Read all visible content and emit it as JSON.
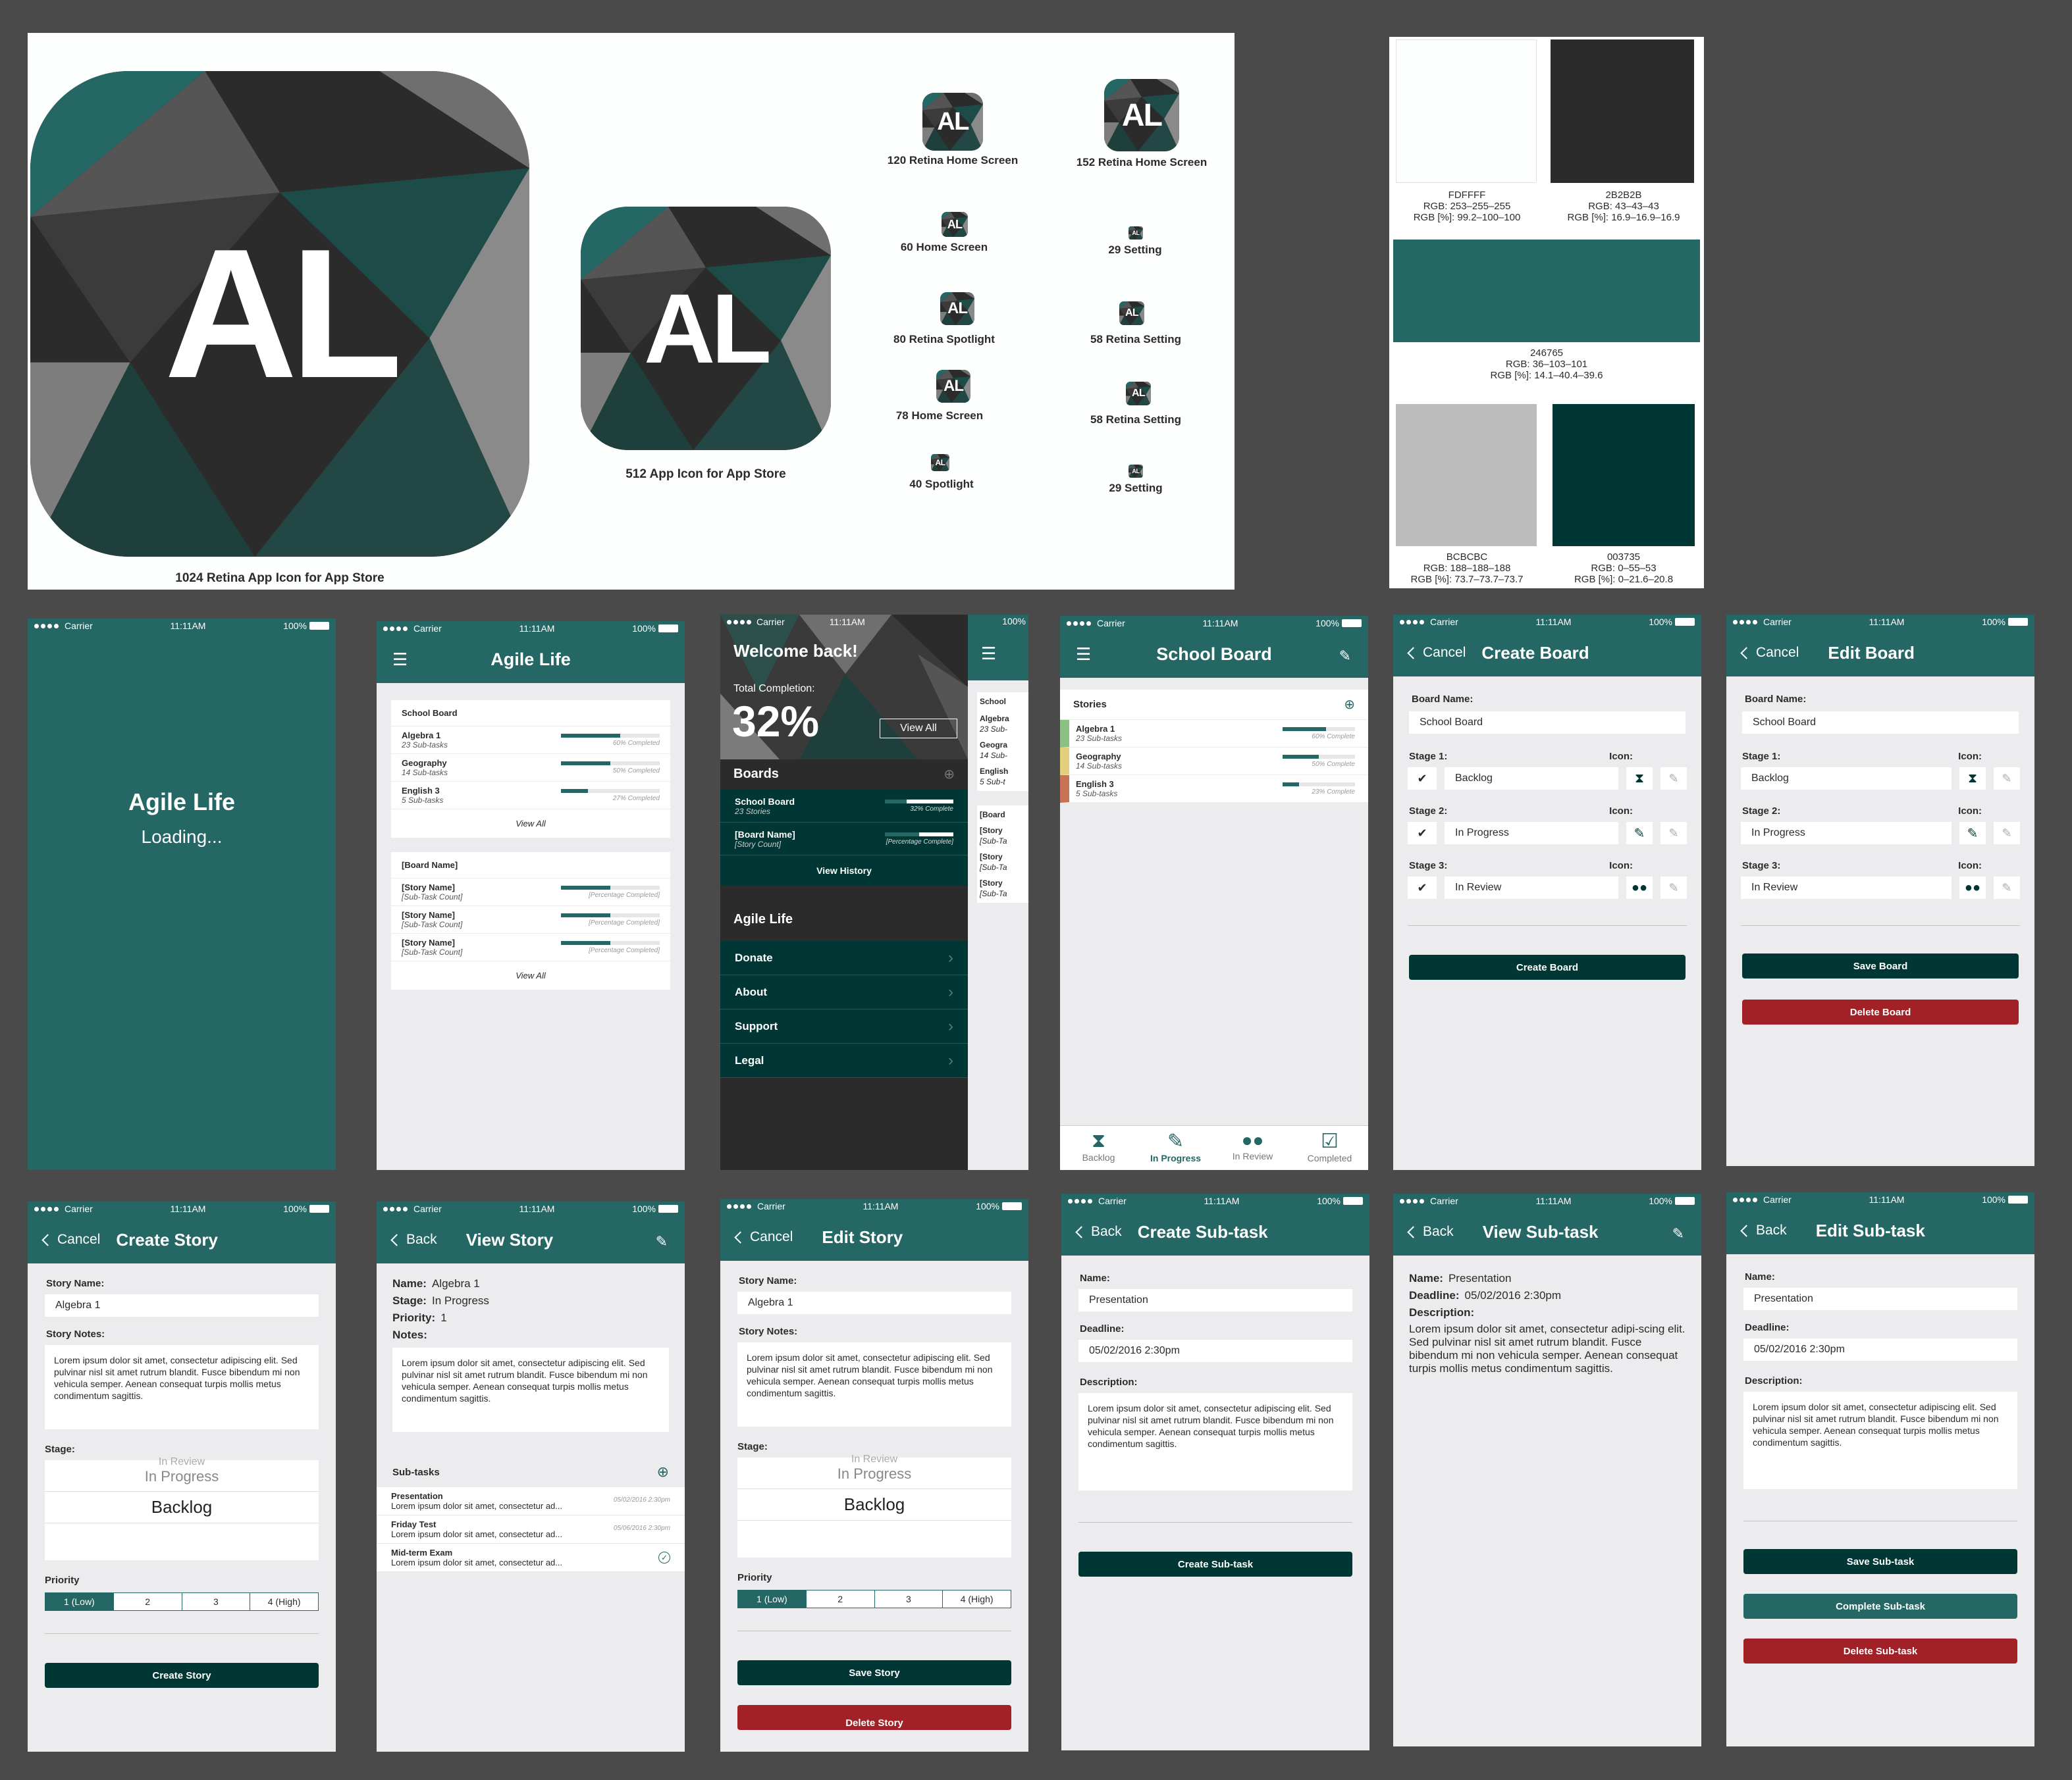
{
  "icon_sheet": {
    "mark": "AL",
    "captions": {
      "i1024": "1024 Retina App Icon for App Store",
      "i512": "512 App Icon for App Store",
      "i120": "120 Retina Home Screen",
      "i152": "152 Retina Home Screen",
      "i60": "60 Home Screen",
      "i29a": "29 Setting",
      "i80": "80 Retina Spotlight",
      "i58a": "58 Retina Setting",
      "i78": "78 Home Screen",
      "i58b": "58 Retina Setting",
      "i40": "40 Spotlight",
      "i29b": "29 Setting"
    }
  },
  "palette": [
    {
      "hex": "FDFFFF",
      "rgb": "RGB: 253–255–255",
      "pct": "RGB [%]: 99.2–100–100",
      "color": "#fdffff"
    },
    {
      "hex": "2B2B2B",
      "rgb": "RGB: 43–43–43",
      "pct": "RGB [%]: 16.9–16.9–16.9",
      "color": "#2b2b2b"
    },
    {
      "hex": "246765",
      "rgb": "RGB: 36–103–101",
      "pct": "RGB [%]: 14.1–40.4–39.6",
      "color": "#246765"
    },
    {
      "hex": "BCBCBC",
      "rgb": "RGB: 188–188–188",
      "pct": "RGB [%]: 73.7–73.7–73.7",
      "color": "#bcbcbc"
    },
    {
      "hex": "003735",
      "rgb": "RGB: 0–55–53",
      "pct": "RGB [%]: 0–21.6–20.8",
      "color": "#003735"
    }
  ],
  "status": {
    "carrier": "Carrier",
    "time": "11:11AM",
    "battery": "100%"
  },
  "splash": {
    "title": "Agile Life",
    "loading": "Loading..."
  },
  "home": {
    "title": "Agile Life",
    "board1": {
      "name": "School Board",
      "view_all": "View All",
      "items": [
        {
          "name": "Algebra 1",
          "sub": "23 Sub-tasks",
          "pct_label": "60% Completed",
          "pct": 0.6
        },
        {
          "name": "Geography",
          "sub": "14 Sub-tasks",
          "pct_label": "50% Completed",
          "pct": 0.5
        },
        {
          "name": "English 3",
          "sub": "5 Sub-tasks",
          "pct_label": "27% Completed",
          "pct": 0.27
        }
      ]
    },
    "board2": {
      "name": "[Board Name]",
      "view_all": "View All",
      "items": [
        {
          "name": "[Story Name]",
          "sub": "[Sub-Task Count]",
          "pct_label": "[Percentage Completed]",
          "pct": 0.5
        },
        {
          "name": "[Story Name]",
          "sub": "[Sub-Task Count]",
          "pct_label": "[Percentage Completed]",
          "pct": 0.5
        },
        {
          "name": "[Story Name]",
          "sub": "[Sub-Task Count]",
          "pct_label": "[Percentage Completed]",
          "pct": 0.5
        }
      ]
    }
  },
  "menu": {
    "welcome": "Welcome back!",
    "total_label": "Total Completion:",
    "total_value": "32%",
    "view_all": "View All",
    "boards_label": "Boards",
    "boards": [
      {
        "name": "School Board",
        "sub": "23 Stories",
        "pct_label": "32% Complete",
        "pct": 0.32
      },
      {
        "name": "[Board Name]",
        "sub": "[Story Count]",
        "pct_label": "[Percentage Complete]",
        "pct": 0.5
      }
    ],
    "view_history": "View History",
    "app_section": "Agile Life",
    "items": [
      "Donate",
      "About",
      "Support",
      "Legal"
    ],
    "peek": {
      "school": "School",
      "algebra": "Algebra",
      "sub23": "23 Sub-",
      "geo": "Geogra",
      "sub14": "14 Sub-",
      "eng": "English",
      "sub5": "5 Sub-t",
      "board": "[Board",
      "story": "[Story",
      "subtask": "[Sub-Ta"
    }
  },
  "school_board": {
    "title": "School Board",
    "stories_label": "Stories",
    "items": [
      {
        "name": "Algebra 1",
        "sub": "23 Sub-tasks",
        "pct_label": "60% Complete",
        "pct": 0.6,
        "color": "#8cc084"
      },
      {
        "name": "Geography",
        "sub": "14 Sub-tasks",
        "pct_label": "50% Complete",
        "pct": 0.5,
        "color": "#e2d07c"
      },
      {
        "name": "English 3",
        "sub": "5 Sub-tasks",
        "pct_label": "23% Complete",
        "pct": 0.23,
        "color": "#c77355"
      }
    ],
    "tabs": [
      "Backlog",
      "In Progress",
      "In Review",
      "Completed"
    ]
  },
  "create_board": {
    "cancel": "Cancel",
    "title": "Create Board",
    "board_name_label": "Board Name:",
    "board_name": "School Board",
    "stage1": "Stage 1:",
    "stage2": "Stage 2:",
    "stage3": "Stage 3:",
    "icon_label": "Icon:",
    "s1": "Backlog",
    "s2": "In Progress",
    "s3": "In Review",
    "button": "Create Board"
  },
  "edit_board": {
    "cancel": "Cancel",
    "title": "Edit Board",
    "board_name_label": "Board Name:",
    "board_name": "School Board",
    "stage1": "Stage 1:",
    "stage2": "Stage 2:",
    "stage3": "Stage 3:",
    "icon_label": "Icon:",
    "s1": "Backlog",
    "s2": "In Progress",
    "s3": "In Review",
    "save": "Save Board",
    "delete": "Delete Board"
  },
  "create_story": {
    "cancel": "Cancel",
    "title": "Create Story",
    "name_label": "Story Name:",
    "name": "Algebra 1",
    "notes_label": "Story Notes:",
    "notes": "Lorem ipsum dolor sit amet, consectetur adipiscing elit. Sed pulvinar nisl sit amet rutrum blandit. Fusce bibendum mi non vehicula semper. Aenean consequat turpis mollis metus condimentum sagittis.",
    "stage_label": "Stage:",
    "picker": [
      "In Review",
      "In Progress",
      "Backlog"
    ],
    "priority_label": "Priority",
    "priorities": [
      "1 (Low)",
      "2",
      "3",
      "4 (High)"
    ],
    "button": "Create Story"
  },
  "view_story": {
    "back": "Back",
    "title": "View Story",
    "name_k": "Name:",
    "name_v": "Algebra 1",
    "stage_k": "Stage:",
    "stage_v": "In Progress",
    "priority_k": "Priority:",
    "priority_v": "1",
    "notes_k": "Notes:",
    "notes": "Lorem ipsum dolor sit amet, consectetur adipiscing elit. Sed pulvinar nisl sit amet rutrum blandit. Fusce bibendum mi non vehicula semper. Aenean consequat turpis mollis metus condimentum sagittis.",
    "subtasks_label": "Sub-tasks",
    "subtasks": [
      {
        "name": "Presentation",
        "desc": "Lorem ipsum dolor sit amet, consectetur ad...",
        "date": "05/02/2016 2:30pm"
      },
      {
        "name": "Friday Test",
        "desc": "Lorem ipsum dolor sit amet, consectetur ad...",
        "date": "05/06/2016 2:30pm"
      },
      {
        "name": "Mid-term Exam",
        "desc": "Lorem ipsum dolor sit amet, consectetur ad...",
        "date": ""
      }
    ]
  },
  "edit_story": {
    "cancel": "Cancel",
    "title": "Edit Story",
    "name_label": "Story Name:",
    "name": "Algebra 1",
    "notes_label": "Story Notes:",
    "notes": "Lorem ipsum dolor sit amet, consectetur adipiscing elit. Sed pulvinar nisl sit amet rutrum blandit. Fusce bibendum mi non vehicula semper. Aenean consequat turpis mollis metus condimentum sagittis.",
    "stage_label": "Stage:",
    "picker": [
      "In Review",
      "In Progress",
      "Backlog"
    ],
    "priority_label": "Priority",
    "priorities": [
      "1 (Low)",
      "2",
      "3",
      "4 (High)"
    ],
    "save": "Save Story",
    "delete": "Delete Story"
  },
  "create_subtask": {
    "back": "Back",
    "title": "Create Sub-task",
    "name_label": "Name:",
    "name": "Presentation",
    "deadline_label": "Deadline:",
    "deadline": "05/02/2016 2:30pm",
    "desc_label": "Description:",
    "desc": "Lorem ipsum dolor sit amet, consectetur adipiscing elit. Sed pulvinar nisl sit amet rutrum blandit. Fusce bibendum mi non vehicula semper. Aenean consequat turpis mollis metus condimentum sagittis.",
    "button": "Create Sub-task"
  },
  "view_subtask": {
    "back": "Back",
    "title": "View Sub-task",
    "name_k": "Name:",
    "name_v": "Presentation",
    "deadline_k": "Deadline:",
    "deadline_v": "05/02/2016 2:30pm",
    "desc_k": "Description:",
    "desc": "Lorem ipsum dolor sit amet, consectetur adipi-scing elit. Sed pulvinar nisl sit amet rutrum blandit. Fusce bibendum mi non vehicula semper. Aenean consequat turpis mollis metus condimentum sagittis."
  },
  "edit_subtask": {
    "back": "Back",
    "title": "Edit Sub-task",
    "name_label": "Name:",
    "name": "Presentation",
    "deadline_label": "Deadline:",
    "deadline": "05/02/2016 2:30pm",
    "desc_label": "Description:",
    "desc": "Lorem ipsum dolor sit amet, consectetur adipiscing elit. Sed pulvinar nisl sit amet rutrum blandit. Fusce bibendum mi non vehicula semper. Aenean consequat turpis mollis metus condimentum sagittis.",
    "save": "Save Sub-task",
    "complete": "Complete Sub-task",
    "delete": "Delete Sub-task"
  }
}
